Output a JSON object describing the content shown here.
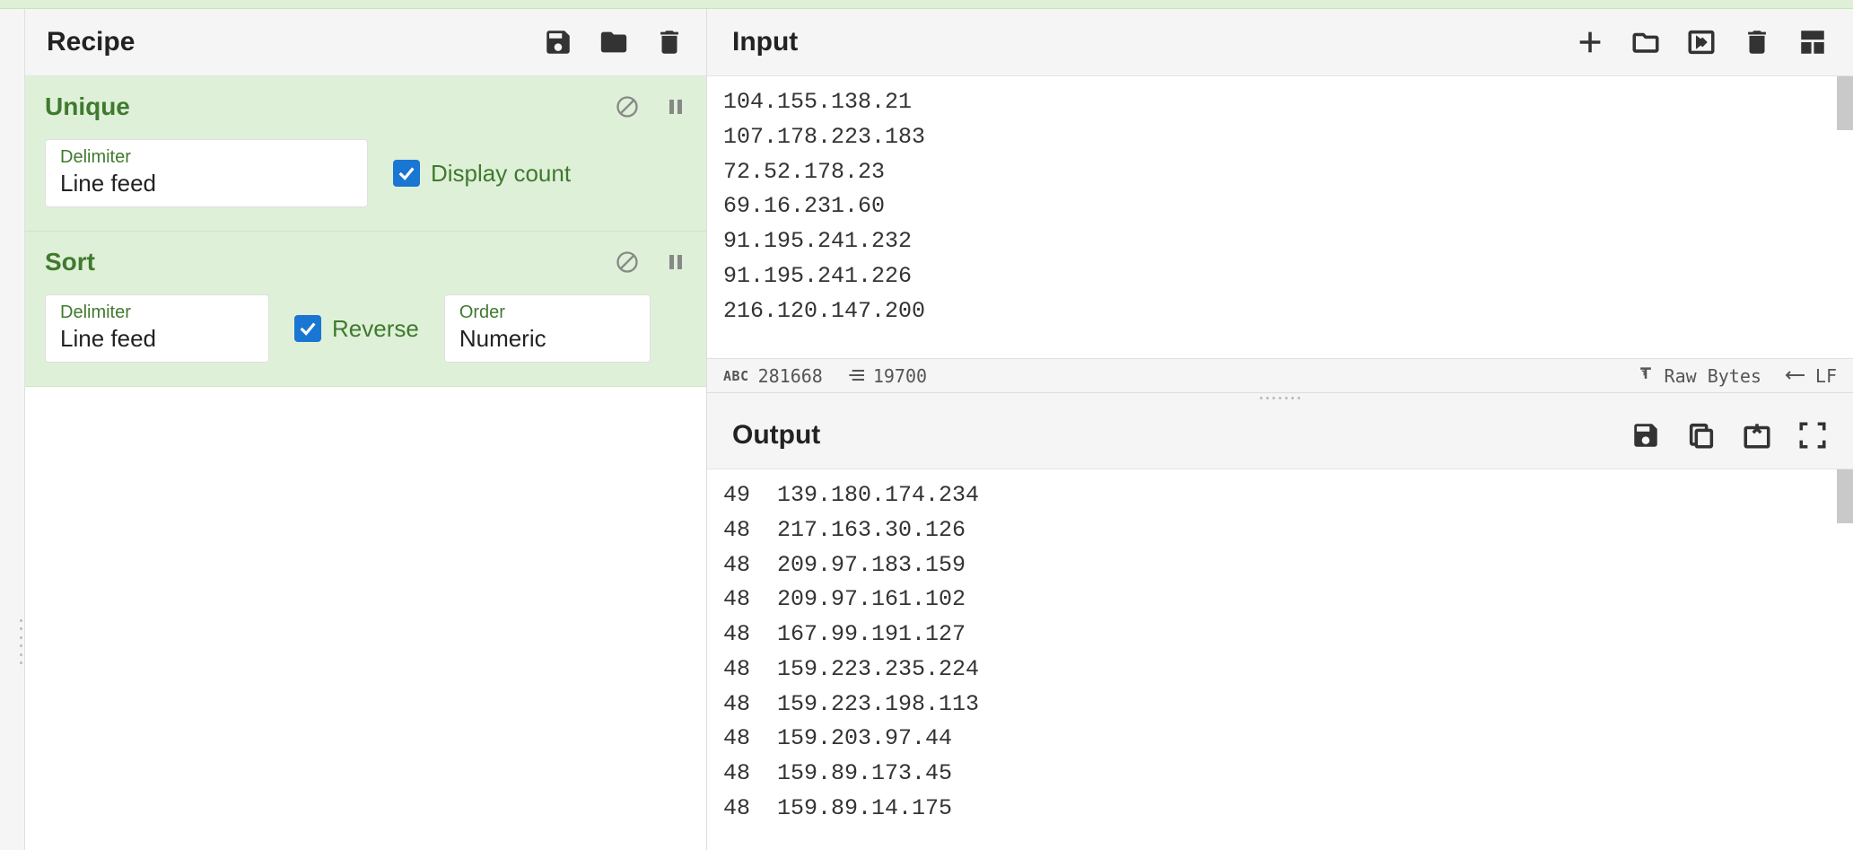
{
  "recipe": {
    "title": "Recipe",
    "operations": [
      {
        "name": "Unique",
        "args": {
          "delimiter": {
            "label": "Delimiter",
            "value": "Line feed"
          },
          "display_count": {
            "label": "Display count",
            "checked": true
          }
        }
      },
      {
        "name": "Sort",
        "args": {
          "delimiter": {
            "label": "Delimiter",
            "value": "Line feed"
          },
          "reverse": {
            "label": "Reverse",
            "checked": true
          },
          "order": {
            "label": "Order",
            "value": "Numeric"
          }
        }
      }
    ]
  },
  "input": {
    "title": "Input",
    "lines": [
      "104.155.138.21",
      "107.178.223.183",
      "72.52.178.23",
      "69.16.231.60",
      "91.195.241.232",
      "91.195.241.226",
      "216.120.147.200"
    ],
    "status": {
      "char_count": "281668",
      "line_count": "19700",
      "encoding": "Raw Bytes",
      "eol": "LF"
    }
  },
  "output": {
    "title": "Output",
    "lines": [
      "49  139.180.174.234",
      "48  217.163.30.126",
      "48  209.97.183.159",
      "48  209.97.161.102",
      "48  167.99.191.127",
      "48  159.223.235.224",
      "48  159.223.198.113",
      "48  159.203.97.44",
      "48  159.89.173.45",
      "48  159.89.14.175"
    ]
  }
}
